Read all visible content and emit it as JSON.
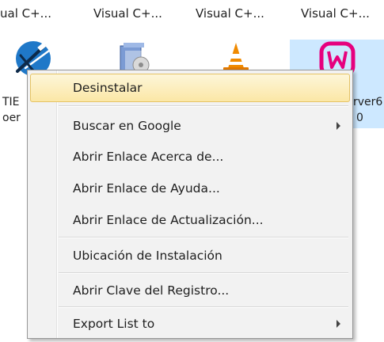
{
  "top_labels": [
    "ual C+...",
    "Visual C+...",
    "Visual C+...",
    "Visual C+..."
  ],
  "tiles": [
    {
      "icon": "telescope-icon",
      "caption_lines": [
        "TIE",
        "oer"
      ]
    },
    {
      "icon": "installer-box-icon",
      "caption_lines": []
    },
    {
      "icon": "vlc-cone-icon",
      "caption_lines": []
    },
    {
      "icon": "wampserver-icon",
      "caption_lines": [
        "rver6",
        "0"
      ],
      "selected": true
    }
  ],
  "context_menu": {
    "items": [
      {
        "label": "Desinstalar",
        "hover": true,
        "submenu": false
      },
      {
        "label": "Buscar en Google",
        "submenu": true
      },
      {
        "label": "Abrir Enlace Acerca de...",
        "submenu": false
      },
      {
        "label": "Abrir Enlace de Ayuda...",
        "submenu": false
      },
      {
        "label": "Abrir Enlace de Actualización...",
        "submenu": false
      },
      {
        "label": "Ubicación de Instalación",
        "submenu": false
      },
      {
        "label": "Abrir Clave del Registro...",
        "submenu": false
      },
      {
        "label": "Export List to",
        "submenu": true
      }
    ]
  },
  "colors": {
    "menu_background": "#f2f2f2",
    "hover_highlight": "#fbe7a6",
    "selected_tile": "#cde8ff",
    "wamp_pink": "#e6007e"
  }
}
